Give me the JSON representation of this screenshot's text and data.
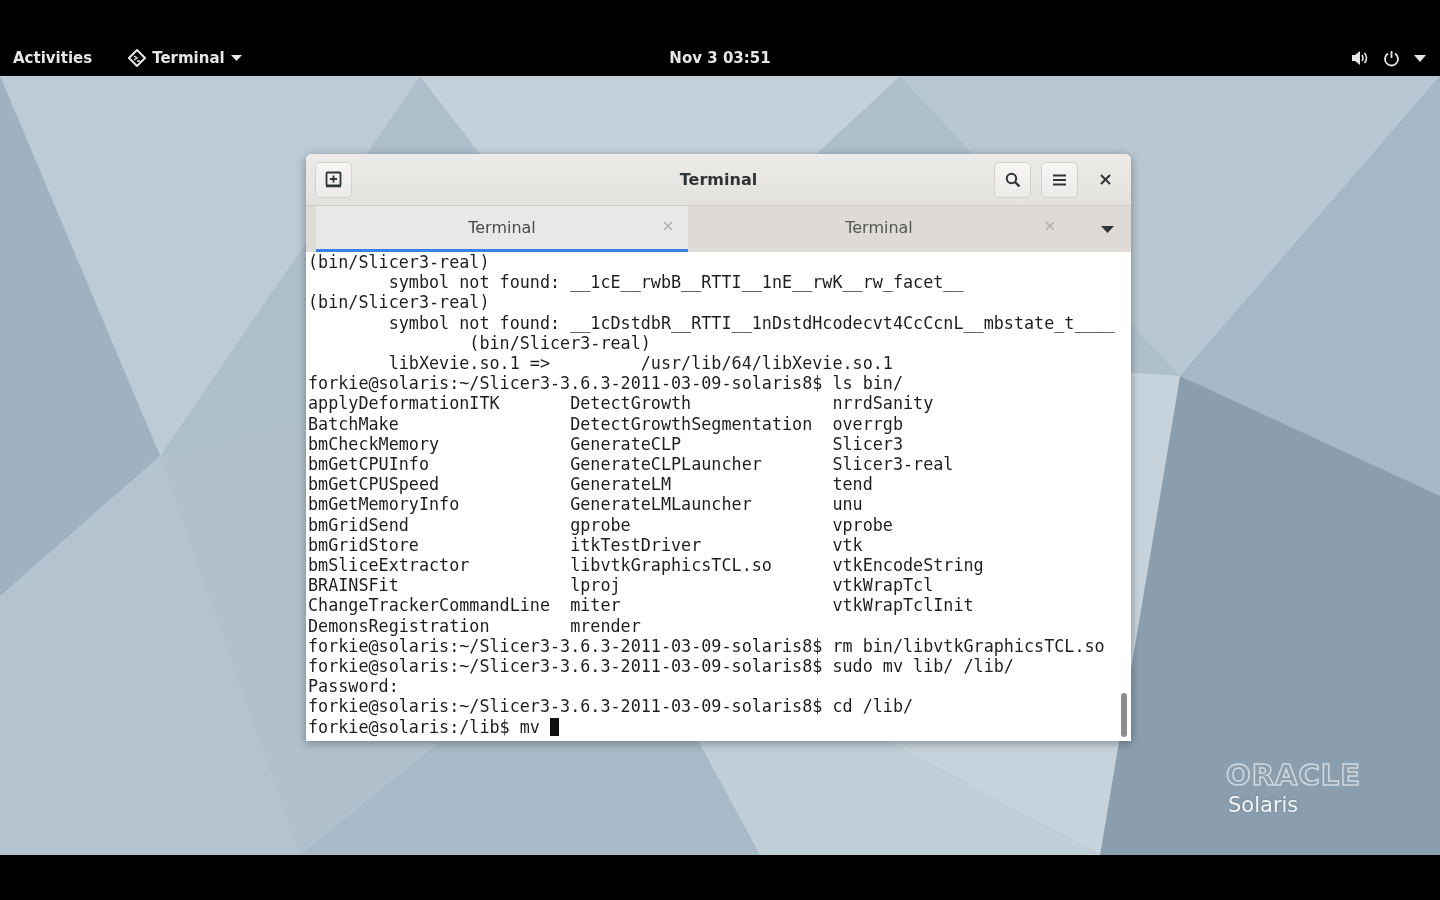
{
  "top_bar": {
    "activities": "Activities",
    "app_menu": "Terminal",
    "clock": "Nov 3 03:51"
  },
  "window": {
    "title": "Terminal",
    "tabs": [
      {
        "label": "Terminal",
        "selected": true
      },
      {
        "label": "Terminal",
        "selected": false
      }
    ],
    "terminal": {
      "lines": [
        "(bin/Slicer3-real)",
        "        symbol not found: __1cE__rwbB__RTTI__1nE__rwK__rw_facet__",
        "(bin/Slicer3-real)",
        "        symbol not found: __1cDstdbR__RTTI__1nDstdHcodecvt4CcCcnL__mbstate_t____",
        "                (bin/Slicer3-real)",
        "        libXevie.so.1 =>         /usr/lib/64/libXevie.so.1",
        "forkie@solaris:~/Slicer3-3.6.3-2011-03-09-solaris8$ ls bin/",
        "applyDeformationITK       DetectGrowth              nrrdSanity",
        "BatchMake                 DetectGrowthSegmentation  overrgb",
        "bmCheckMemory             GenerateCLP               Slicer3",
        "bmGetCPUInfo              GenerateCLPLauncher       Slicer3-real",
        "bmGetCPUSpeed             GenerateLM                tend",
        "bmGetMemoryInfo           GenerateLMLauncher        unu",
        "bmGridSend                gprobe                    vprobe",
        "bmGridStore               itkTestDriver             vtk",
        "bmSliceExtractor          libvtkGraphicsTCL.so      vtkEncodeString",
        "BRAINSFit                 lproj                     vtkWrapTcl",
        "ChangeTrackerCommandLine  miter                     vtkWrapTclInit",
        "DemonsRegistration        mrender",
        "forkie@solaris:~/Slicer3-3.6.3-2011-03-09-solaris8$ rm bin/libvtkGraphicsTCL.so",
        "forkie@solaris:~/Slicer3-3.6.3-2011-03-09-solaris8$ sudo mv lib/ /lib/",
        "Password:",
        "forkie@solaris:~/Slicer3-3.6.3-2011-03-09-solaris8$ cd /lib/"
      ],
      "prompt_line": "forkie@solaris:/lib$ mv"
    }
  },
  "wallpaper": {
    "logo": "ORACLE",
    "logo_subtitle": "Solaris"
  }
}
